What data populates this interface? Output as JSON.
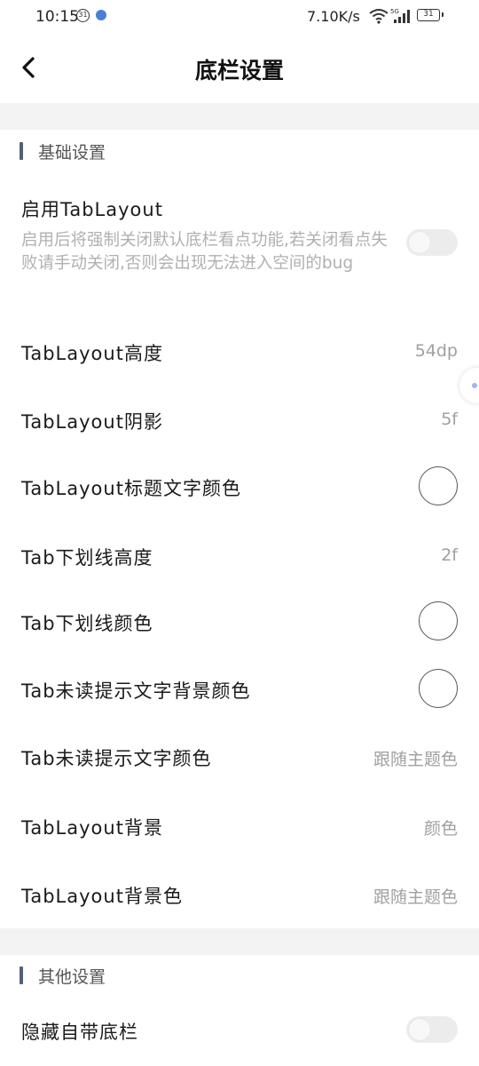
{
  "status_bar": {
    "time": "10:15",
    "badge": "31",
    "speed": "7.10K/s",
    "battery": "31"
  },
  "header": {
    "title": "底栏设置"
  },
  "sections": [
    {
      "title": "基础设置"
    },
    {
      "title": "其他设置"
    }
  ],
  "rows": {
    "enable_tablayout": {
      "label": "启用TabLayout",
      "description": "启用后将强制关闭默认底栏看点功能,若关闭看点失败请手动关闭,否则会出现无法进入空间的bug",
      "enabled": false
    },
    "tablayout_height": {
      "label": "TabLayout高度",
      "value": "54dp"
    },
    "tablayout_shadow": {
      "label": "TabLayout阴影",
      "value": "5f"
    },
    "tablayout_title_color": {
      "label": "TabLayout标题文字颜色",
      "color": "#ffffff"
    },
    "tab_underline_height": {
      "label": "Tab下划线高度",
      "value": "2f"
    },
    "tab_underline_color": {
      "label": "Tab下划线颜色",
      "color": "#ffffff"
    },
    "tab_unread_bg_color": {
      "label": "Tab未读提示文字背景颜色",
      "color": "#ffffff"
    },
    "tab_unread_text_color": {
      "label": "Tab未读提示文字颜色",
      "value": "跟随主题色"
    },
    "tablayout_background": {
      "label": "TabLayout背景",
      "value": "颜色"
    },
    "tablayout_background_color": {
      "label": "TabLayout背景色",
      "value": "跟随主题色"
    },
    "hide_builtin_bar": {
      "label": "隐藏自带底栏",
      "enabled": false
    }
  },
  "colors": {
    "section_accent": "#54607a",
    "gap_background": "#f3f3f3",
    "secondary_text": "#a0a0a0"
  }
}
